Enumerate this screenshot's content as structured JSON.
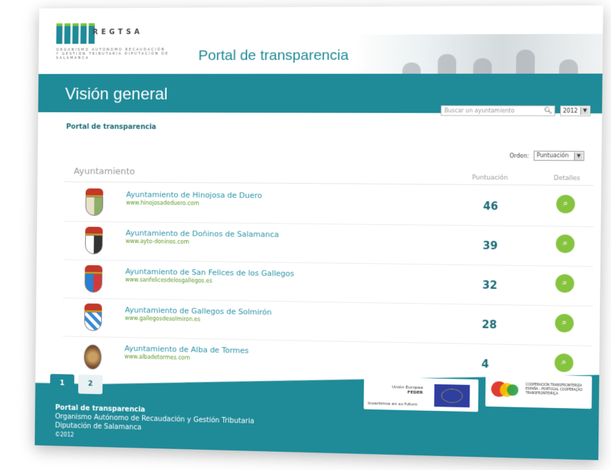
{
  "header": {
    "logo_name": "REGTSA",
    "logo_sub": "ORGANISMO AUTÓNOMO RECAUDACIÓN Y GESTIÓN TRIBUTARIA DIPUTACIÓN DE SALAMANCA",
    "portal_title": "Portal de transparencia"
  },
  "banner": {
    "title": "Visión general",
    "search_placeholder": "Buscar un ayuntamiento",
    "year": "2012"
  },
  "breadcrumb": "Portal de transparencia",
  "table": {
    "orden_label": "Orden:",
    "orden_value": "Puntuación",
    "col_ayuntamiento": "Ayuntamiento",
    "col_puntuacion": "Puntuación",
    "col_detalles": "Detalles",
    "rows": [
      {
        "name": "Ayuntamiento de Hinojosa de Duero",
        "url": "www.hinojosadeduero.com",
        "score": "46"
      },
      {
        "name": "Ayuntamiento de Doñinos de Salamanca",
        "url": "www.ayto-doninos.com",
        "score": "39"
      },
      {
        "name": "Ayuntamiento de San Felices de los Gallegos",
        "url": "www.sanfelicesdelosgallegos.es",
        "score": "32"
      },
      {
        "name": "Ayuntamiento de Gallegos de Solmirón",
        "url": "www.gallegosdesolmiron.es",
        "score": "28"
      },
      {
        "name": "Ayuntamiento de Alba de Tormes",
        "url": "www.albadetormes.com",
        "score": "4"
      }
    ]
  },
  "pagination": {
    "page1": "1",
    "page2": "2"
  },
  "footer": {
    "line1": "Portal de transparencia",
    "line2": "Organismo Autónomo de Recaudación y Gestión Tributaria",
    "line3": "Diputación de Salamanca",
    "line4": "©2012",
    "eu_line1": "Unión Europea",
    "eu_line2": "FEDER",
    "eu_line3": "Invertimos en su futuro",
    "poctep": "COOPERACIÓN TRANSFRONTERIZA ESPAÑA - PORTUGAL COOPERAÇÃO TRANSFRONTEIRIÇA"
  },
  "colors": {
    "teal": "#1f8a98",
    "green": "#86c440"
  }
}
